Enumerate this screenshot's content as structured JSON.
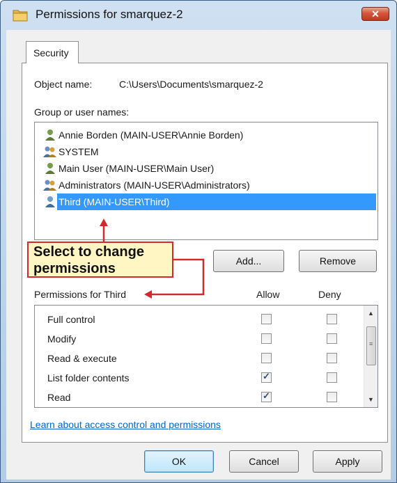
{
  "window": {
    "title": "Permissions for smarquez-2",
    "close_label": "✕"
  },
  "tabs": [
    {
      "label": "Security",
      "selected": true
    }
  ],
  "object": {
    "label": "Object name:",
    "value": "C:\\Users\\Documents\\smarquez-2"
  },
  "users": {
    "label": "Group or user names:",
    "items": [
      {
        "name": "Annie Borden (MAIN-USER\\Annie Borden)",
        "icon": "user-icon",
        "selected": false
      },
      {
        "name": "SYSTEM",
        "icon": "group-icon",
        "selected": false
      },
      {
        "name": "Main User (MAIN-USER\\Main User)",
        "icon": "user-icon",
        "selected": false
      },
      {
        "name": "Administrators (MAIN-USER\\Administrators)",
        "icon": "group-icon",
        "selected": false
      },
      {
        "name": "Third (MAIN-USER\\Third)",
        "icon": "user-icon",
        "selected": true
      }
    ],
    "add_label": "Add...",
    "remove_label": "Remove"
  },
  "annotation": {
    "text_line1": "Select to change",
    "text_line2": "permissions",
    "border_color": "#d22a2a",
    "fill_color": "#fff6c4"
  },
  "permissions": {
    "label": "Permissions for Third",
    "allow_header": "Allow",
    "deny_header": "Deny",
    "rows": [
      {
        "name": "Full control",
        "allow": false,
        "deny": false
      },
      {
        "name": "Modify",
        "allow": false,
        "deny": false
      },
      {
        "name": "Read & execute",
        "allow": false,
        "deny": false
      },
      {
        "name": "List folder contents",
        "allow": true,
        "deny": false
      },
      {
        "name": "Read",
        "allow": true,
        "deny": false
      }
    ]
  },
  "link": {
    "text": "Learn about access control and permissions"
  },
  "footer": {
    "ok_label": "OK",
    "cancel_label": "Cancel",
    "apply_label": "Apply"
  },
  "colors": {
    "selection": "#3399ff",
    "link": "#0066cc",
    "annotation_red": "#d22a2a"
  }
}
